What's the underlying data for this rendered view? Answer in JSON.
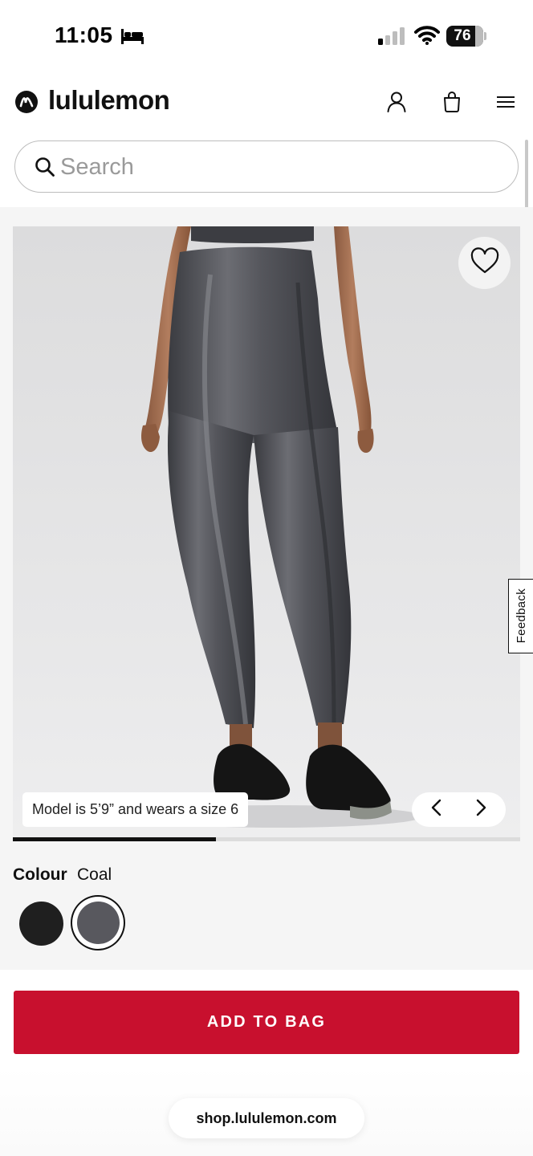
{
  "status_bar": {
    "time": "11:05",
    "battery_percent": "76",
    "icons": [
      "bed-icon",
      "signal-icon",
      "wifi-icon",
      "battery-icon"
    ]
  },
  "header": {
    "brand": "lululemon",
    "icons": [
      "lululemon-logo-icon",
      "account-icon",
      "shopping-bag-icon",
      "hamburger-menu-icon"
    ]
  },
  "search": {
    "placeholder": "Search"
  },
  "gallery": {
    "model_caption": "Model is 5’9” and wears a size 6",
    "progress_fraction": 0.4,
    "feedback_label": "Feedback",
    "icons": [
      "heart-icon",
      "chevron-left-icon",
      "chevron-right-icon"
    ]
  },
  "colour": {
    "label": "Colour",
    "selected": "Coal",
    "swatches": [
      {
        "name": "Black",
        "color": "#1f1f1f"
      },
      {
        "name": "Coal",
        "color": "#58585e"
      }
    ]
  },
  "cta": {
    "add_to_bag": "ADD TO BAG",
    "accent_color": "#c8102e"
  },
  "browser": {
    "url": "shop.lululemon.com"
  }
}
